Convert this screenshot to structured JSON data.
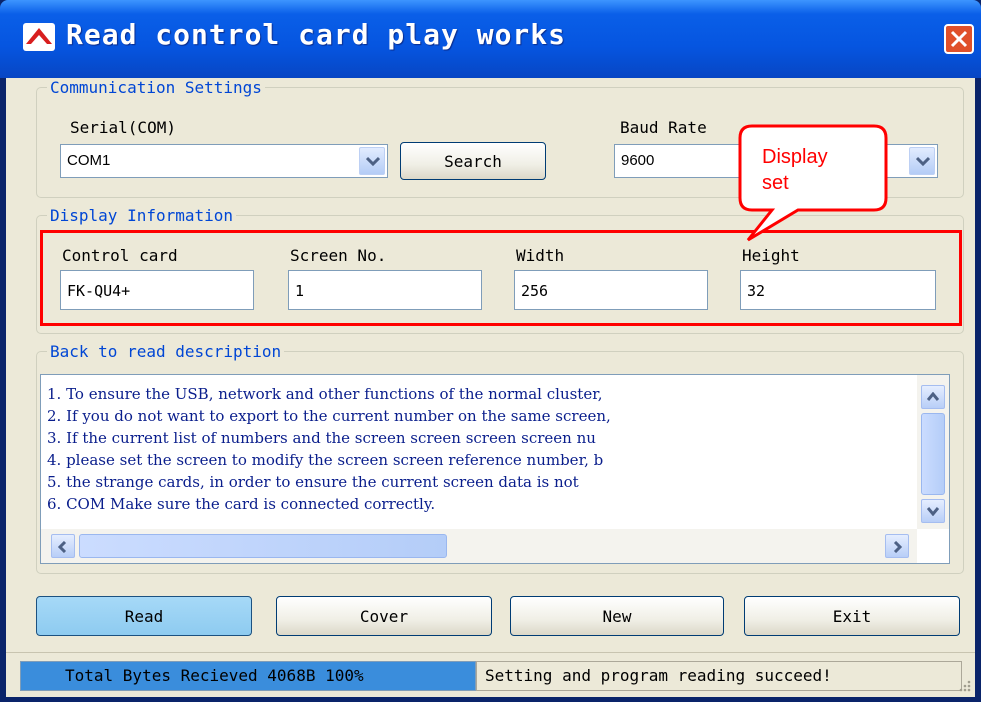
{
  "window": {
    "title": "Read control card play works"
  },
  "communication": {
    "legend": "Communication Settings",
    "serial_label": "Serial(COM)",
    "serial_value": "COM1",
    "search_label": "Search",
    "baud_label": "Baud Rate",
    "baud_value": "9600"
  },
  "display_info": {
    "legend": "Display Information",
    "control_card_label": "Control card",
    "control_card_value": "FK-QU4+",
    "screen_no_label": "Screen No.",
    "screen_no_value": "1",
    "width_label": "Width",
    "width_value": "256",
    "height_label": "Height",
    "height_value": "32"
  },
  "annotation": {
    "text_line1": "Display",
    "text_line2": "set",
    "color": "#ff0000"
  },
  "description": {
    "legend": "Back to read description",
    "lines": [
      "1. To ensure the USB, network and other functions of the normal cluster,",
      "2. If you do not want to export to the current number on the same screen,",
      "3. If the current list of numbers and the screen screen screen screen nu",
      "4. please set the screen to modify the screen screen reference number, b",
      "5. the strange cards, in order to ensure the current screen data is not",
      "6. COM Make sure the card is connected correctly."
    ]
  },
  "buttons": {
    "read": "Read",
    "cover": "Cover",
    "new": "New",
    "exit": "Exit"
  },
  "status": {
    "progress_text": "Total Bytes Recieved 4068B 100%",
    "progress": 1.0,
    "message": "Setting and program reading succeed!"
  },
  "colors": {
    "title_bar": "#0655e0",
    "legend": "#0046d5",
    "accent_button": "#8ecbf0"
  }
}
